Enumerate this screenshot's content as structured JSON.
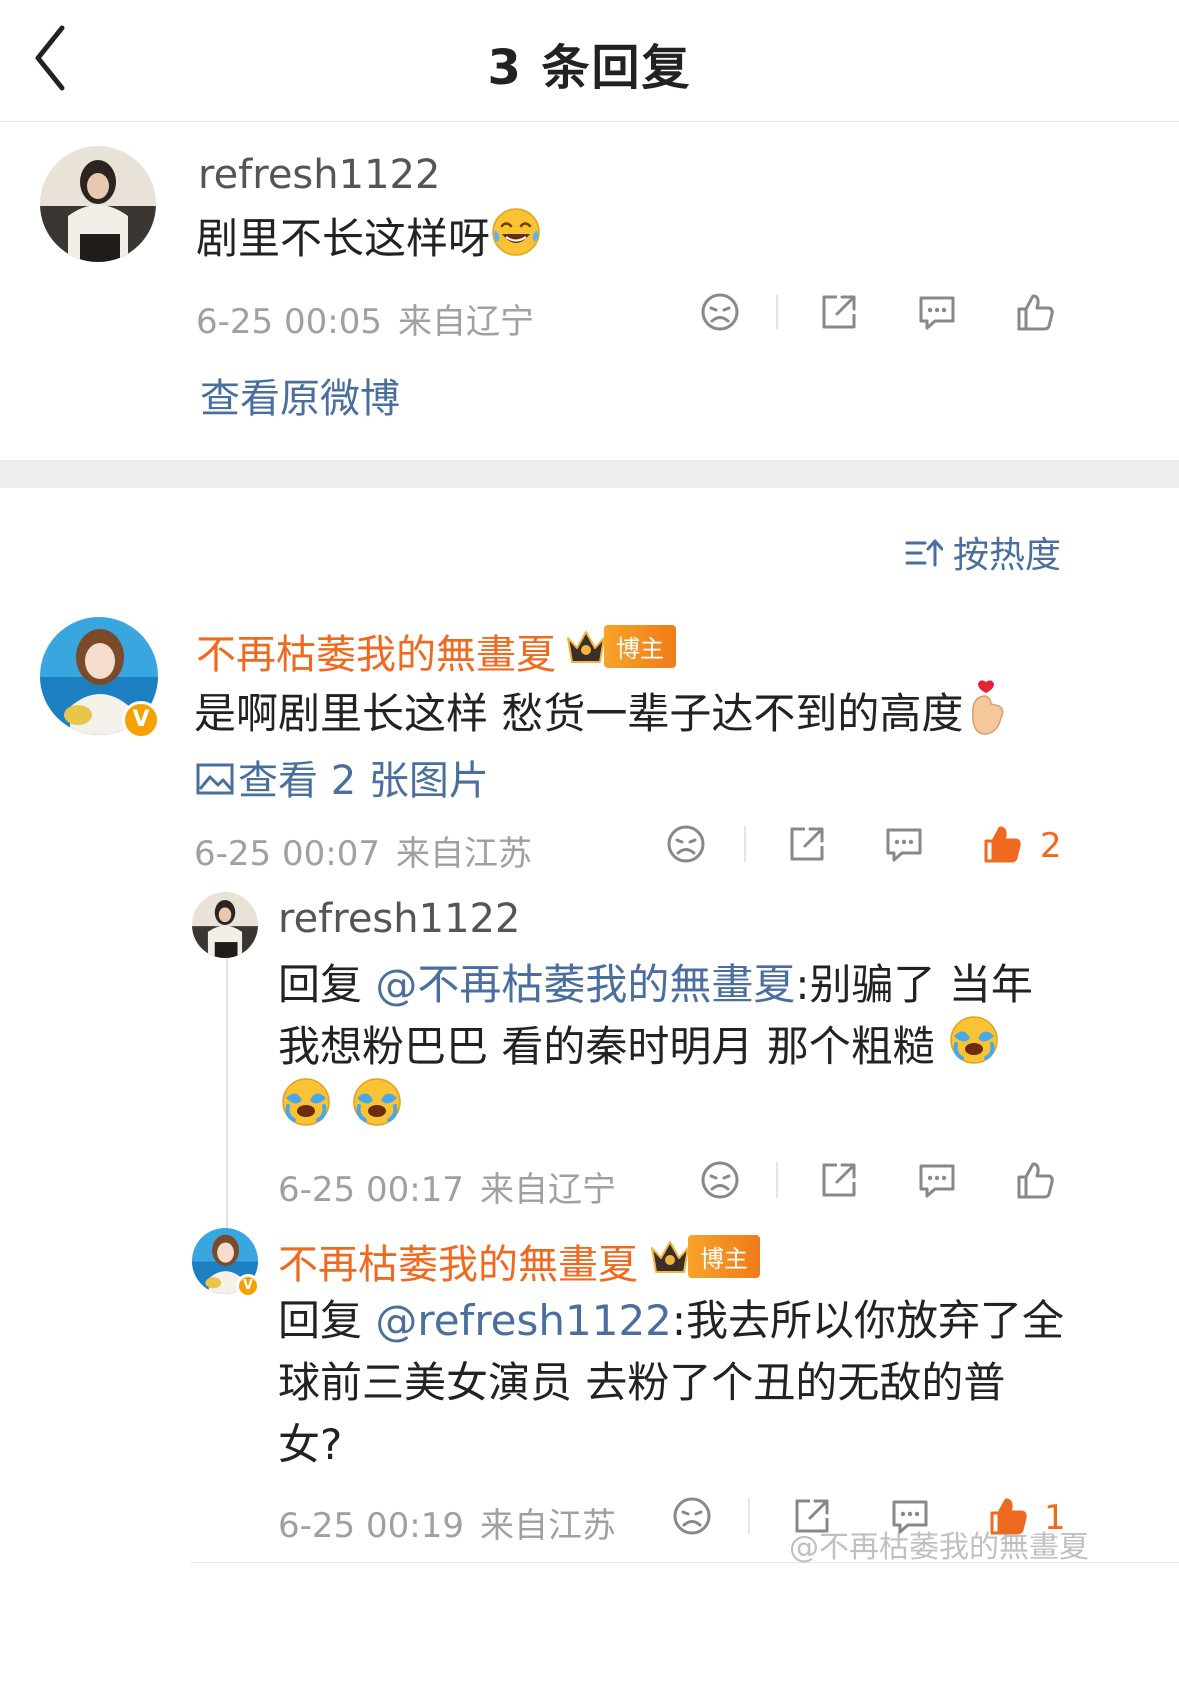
{
  "header": {
    "title": "3 条回复"
  },
  "original": {
    "username": "refresh1122",
    "text": "剧里不长这样呀",
    "time": "6-25 00:05",
    "location": "来自辽宁",
    "view_original": "查看原微博"
  },
  "sort": {
    "label": "按热度"
  },
  "comment": {
    "username": "不再枯萎我的無畫夏",
    "badge": "博主",
    "text": "是啊剧里长这样 愁货一辈子达不到的高度",
    "images_link": "查看 2 张图片",
    "time": "6-25 00:07",
    "location": "来自江苏",
    "like_count": "2"
  },
  "replies": [
    {
      "username": "refresh1122",
      "prefix": "回复 ",
      "mention": "@不再枯萎我的無畫夏",
      "line1": ":别骗了 当年",
      "line2": "我想粉巴巴 看的秦时明月 那个粗糙 ",
      "time": "6-25 00:17",
      "location": "来自辽宁"
    },
    {
      "username": "不再枯萎我的無畫夏",
      "badge": "博主",
      "prefix": "回复 ",
      "mention": "@refresh1122",
      "line1": ":我去所以你放弃了全",
      "line2": "球前三美女演员 去粉了个丑的无敌的普",
      "line3": "女?",
      "time": "6-25 00:19",
      "location": "来自江苏",
      "like_count": "1"
    }
  ],
  "watermark": "@不再枯萎我的無畫夏",
  "colors": {
    "accent_orange": "#ef6a1e",
    "link_blue": "#4a6f9f",
    "meta_gray": "#a0a0a0"
  },
  "icons": [
    "back-arrow-icon",
    "dislike-icon",
    "share-icon",
    "comment-icon",
    "like-icon",
    "sort-icon",
    "image-icon",
    "crown-icon",
    "verified-icon"
  ]
}
